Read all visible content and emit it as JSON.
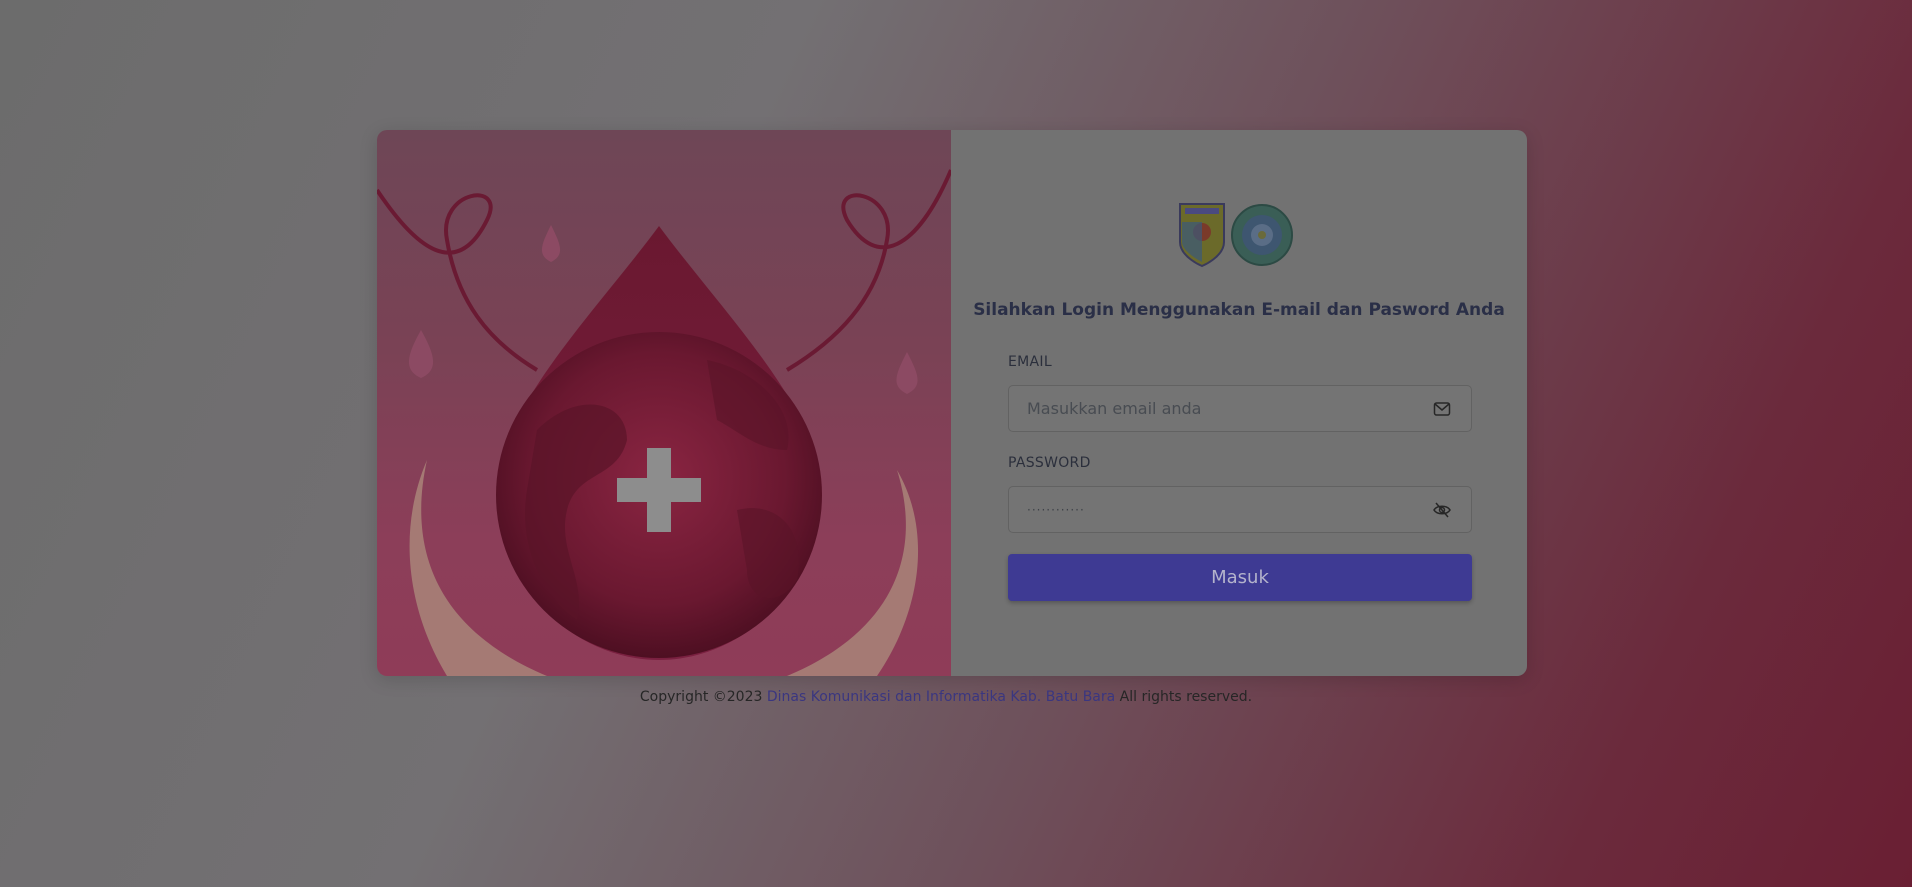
{
  "login": {
    "title": "Silahkan Login Menggunakan E-mail dan Pasword Anda",
    "email_label": "EMAIL",
    "email_placeholder": "Masukkan email anda",
    "email_icon": "envelope-icon",
    "password_label": "PASSWORD",
    "password_value": "············",
    "password_icon": "eye-off-icon",
    "submit_label": "Masuk"
  },
  "logos": [
    "kabupaten-batu-bara-crest",
    "regional-emblem"
  ],
  "footer": {
    "prefix": "Copyright ©2023",
    "link_text": "Dinas Komunikasi dan Informatika Kab. Batu Bara",
    "suffix": "All rights reserved."
  },
  "colors": {
    "primary": "#3e3a93",
    "link": "#3a3680",
    "illustration_bg": "#8c3e59"
  }
}
